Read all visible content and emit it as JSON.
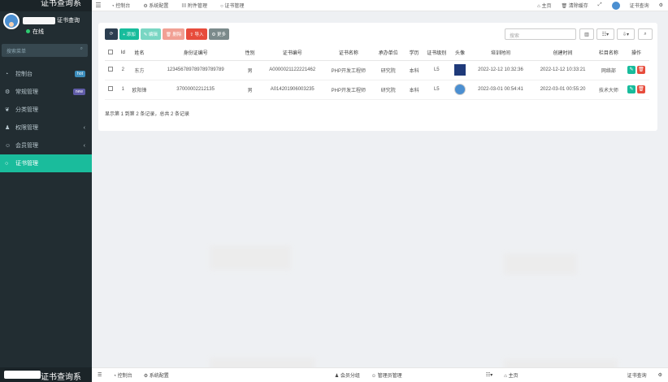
{
  "sidebar": {
    "logo_text": "证书查询系",
    "user_name": "证书查询",
    "status": "在线",
    "search_placeholder": "搜索菜单",
    "items": [
      {
        "label": "控制台",
        "icon": "dashboard-icon",
        "tag": "hot"
      },
      {
        "label": "常规管理",
        "icon": "cogs-icon",
        "tag": "new"
      },
      {
        "label": "分类管理",
        "icon": "leaf-icon"
      },
      {
        "label": "权限管理",
        "icon": "group-icon",
        "arrow": "‹"
      },
      {
        "label": "会员管理",
        "icon": "user-icon",
        "arrow": "‹"
      },
      {
        "label": "证书管理",
        "icon": "circle-icon",
        "active": true
      }
    ],
    "bottom_text": "证书查询系"
  },
  "topbar": {
    "tabs": [
      "控制台",
      "系统配置",
      "附件管理",
      "证书管理"
    ],
    "right": [
      "主页",
      "清除缓存",
      "证书查询"
    ]
  },
  "toolbar": {
    "add": "+ 添加",
    "edit": "✎ 编辑",
    "delete": "🗑 删除",
    "import": "⇪ 导入",
    "more": "⚙ 更多",
    "search_placeholder": "搜索"
  },
  "table": {
    "headers": [
      "Id",
      "姓名",
      "身份证编号",
      "性别",
      "证书编号",
      "证书名称",
      "承办单位",
      "学历",
      "证书级别",
      "头像",
      "培训时间",
      "创建时间",
      "栏目名称",
      "操作"
    ],
    "rows": [
      {
        "id": "2",
        "name": "东方",
        "idcard": "123456789789789789789",
        "gender": "男",
        "cert_no": "A0000021122221462",
        "cert_name": "PHP开发工程师",
        "org": "研究院",
        "edu": "本科",
        "level": "L5",
        "train_time": "2022-12-12 10:32:36",
        "create_time": "2022-12-12 10:33:21",
        "column": "网络部"
      },
      {
        "id": "1",
        "name": "欧阳锋",
        "idcard": "37000002212135",
        "gender": "男",
        "cert_no": "A014201906003235",
        "cert_name": "PHP开发工程师",
        "org": "研究院",
        "edu": "本科",
        "level": "L5",
        "train_time": "2022-03-01 00:54:41",
        "create_time": "2022-03-01 00:55:20",
        "column": "技术大师"
      }
    ],
    "footer": "显示第 1 到第 2 条记录，总共 2 条记录"
  },
  "bottombar": {
    "items": [
      "控制台",
      "系统配置",
      "会员分组",
      "管理员管理",
      "主页",
      "证书查询"
    ]
  }
}
